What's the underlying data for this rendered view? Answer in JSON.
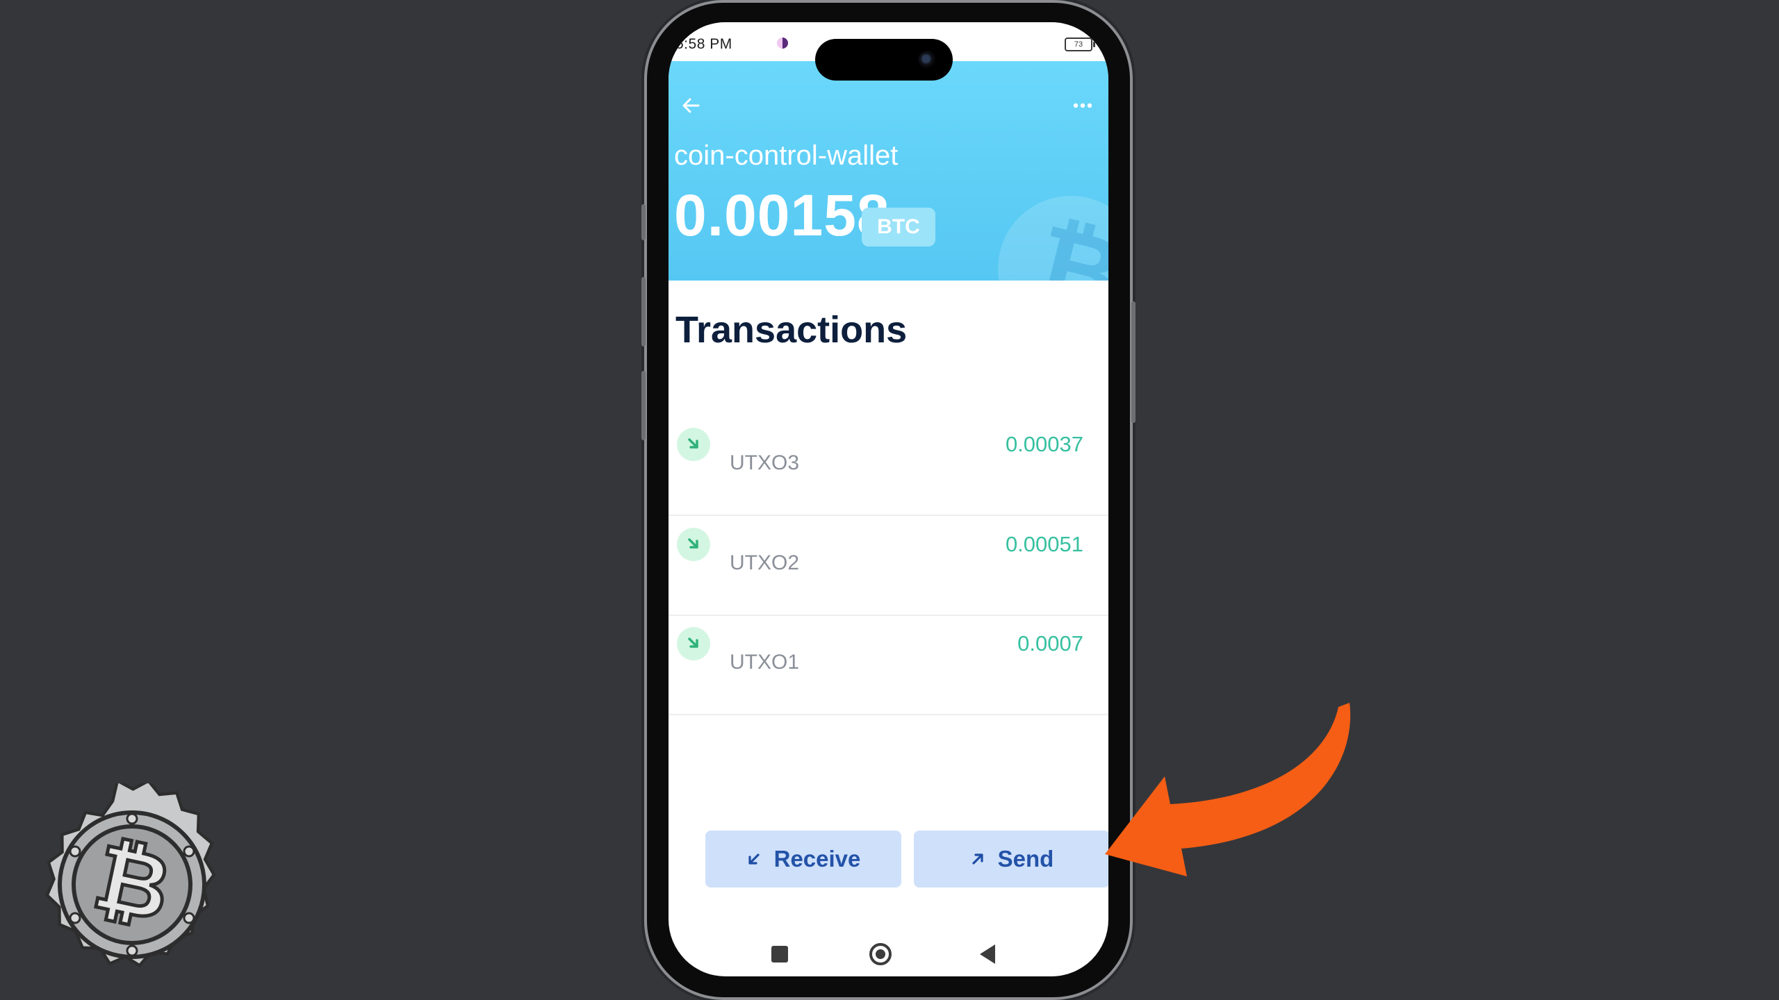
{
  "status_bar": {
    "time": "5:58 PM",
    "battery": "73"
  },
  "header": {
    "back_icon": "arrow-left-icon",
    "more_icon": "more-horizontal-icon",
    "wallet_name": "coin-control-wallet",
    "balance": "0.00158",
    "unit": "BTC",
    "watermark_icon": "bitcoin-icon",
    "accent_color": "#5ccdf5"
  },
  "transactions": {
    "title": "Transactions",
    "items": [
      {
        "label": "UTXO3",
        "amount": "0.00037",
        "icon": "incoming-arrow-icon"
      },
      {
        "label": "UTXO2",
        "amount": "0.00051",
        "icon": "incoming-arrow-icon"
      },
      {
        "label": "UTXO1",
        "amount": "0.0007",
        "icon": "incoming-arrow-icon"
      }
    ],
    "amount_color": "#37c0a0"
  },
  "actions": {
    "receive_label": "Receive",
    "receive_icon": "arrow-down-left-icon",
    "send_label": "Send",
    "send_icon": "arrow-up-right-icon",
    "button_color": "#cfe0fb"
  },
  "nav_bar": {
    "recents_icon": "square-icon",
    "home_icon": "circle-icon",
    "back_icon": "triangle-back-icon"
  },
  "overlay": {
    "logo_icon": "bitcoin-seal-logo",
    "pointer_icon": "curved-arrow-icon",
    "pointer_color": "#f55e14"
  }
}
